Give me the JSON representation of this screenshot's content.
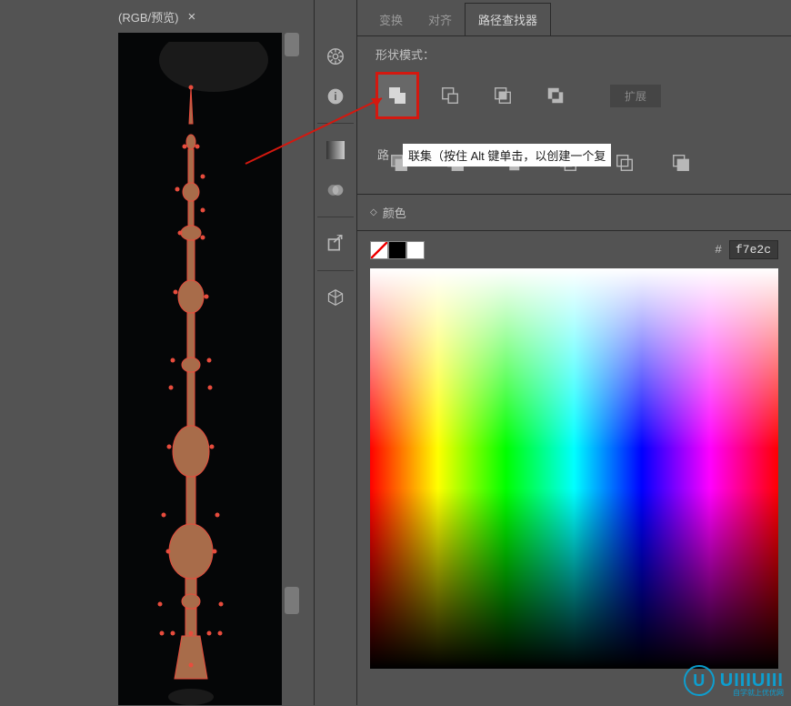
{
  "document_tab": {
    "title": "(RGB/预览)",
    "close": "×"
  },
  "sidebar_icons": [
    "wheel-icon",
    "info-icon",
    "color-icon-separator",
    "gradient-icon",
    "transparency-icon",
    "separator",
    "export-icon",
    "separator",
    "3d-icon"
  ],
  "panel_tabs": {
    "transform": "变换",
    "align": "对齐",
    "pathfinder": "路径查找器"
  },
  "section_labels": {
    "shape_modes": "形状模式：",
    "pathfinders": "路径查找器：",
    "expand": "扩展"
  },
  "tooltip": "联集（按住 Alt 键单击，以创建一个复",
  "path_label_prefix": "路",
  "shape_mode_ops": [
    "unite",
    "minus-front",
    "intersect",
    "exclude"
  ],
  "pathfinder_ops": [
    "divide",
    "trim",
    "merge",
    "crop",
    "outline",
    "minus-back"
  ],
  "color_panel": {
    "title": "颜色",
    "hex_symbol": "#",
    "hex_value": "f7e2c"
  },
  "watermark": {
    "text": "UIIIUIII",
    "sub": "自学就上优优网"
  }
}
